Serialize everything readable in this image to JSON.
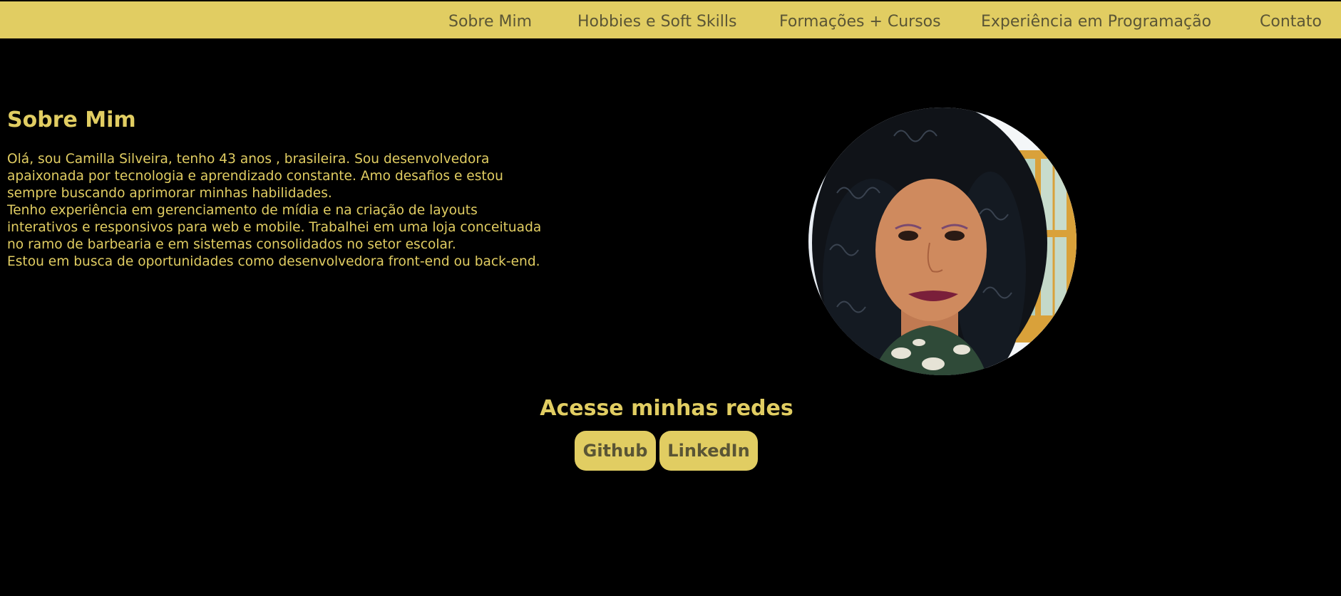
{
  "nav": {
    "items": [
      {
        "label": "Sobre Mim"
      },
      {
        "label": "Hobbies e Soft Skills"
      },
      {
        "label": "Formações + Cursos"
      },
      {
        "label": "Experiência em Programação"
      },
      {
        "label": "Contato"
      }
    ]
  },
  "about": {
    "title": "Sobre Mim",
    "paragraphs": [
      "Olá, sou Camilla Silveira, tenho 43 anos , brasileira. Sou desenvolvedora apaixonada por tecnologia e aprendizado constante. Amo desafios e estou sempre buscando aprimorar minhas habilidades.",
      "Tenho experiência em gerenciamento de mídia e na criação de layouts interativos e responsivos para web e mobile. Trabalhei em uma loja conceituada no ramo de barbearia e em sistemas consolidados no setor escolar.",
      "Estou em busca de oportunidades como desenvolvedora front-end ou back-end."
    ]
  },
  "networks": {
    "title": "Acesse minhas redes",
    "buttons": [
      {
        "label": "Github"
      },
      {
        "label": "LinkedIn"
      }
    ]
  },
  "colors": {
    "accent": "#e1cd62",
    "background": "#000000",
    "nav_text": "#5a5535"
  }
}
